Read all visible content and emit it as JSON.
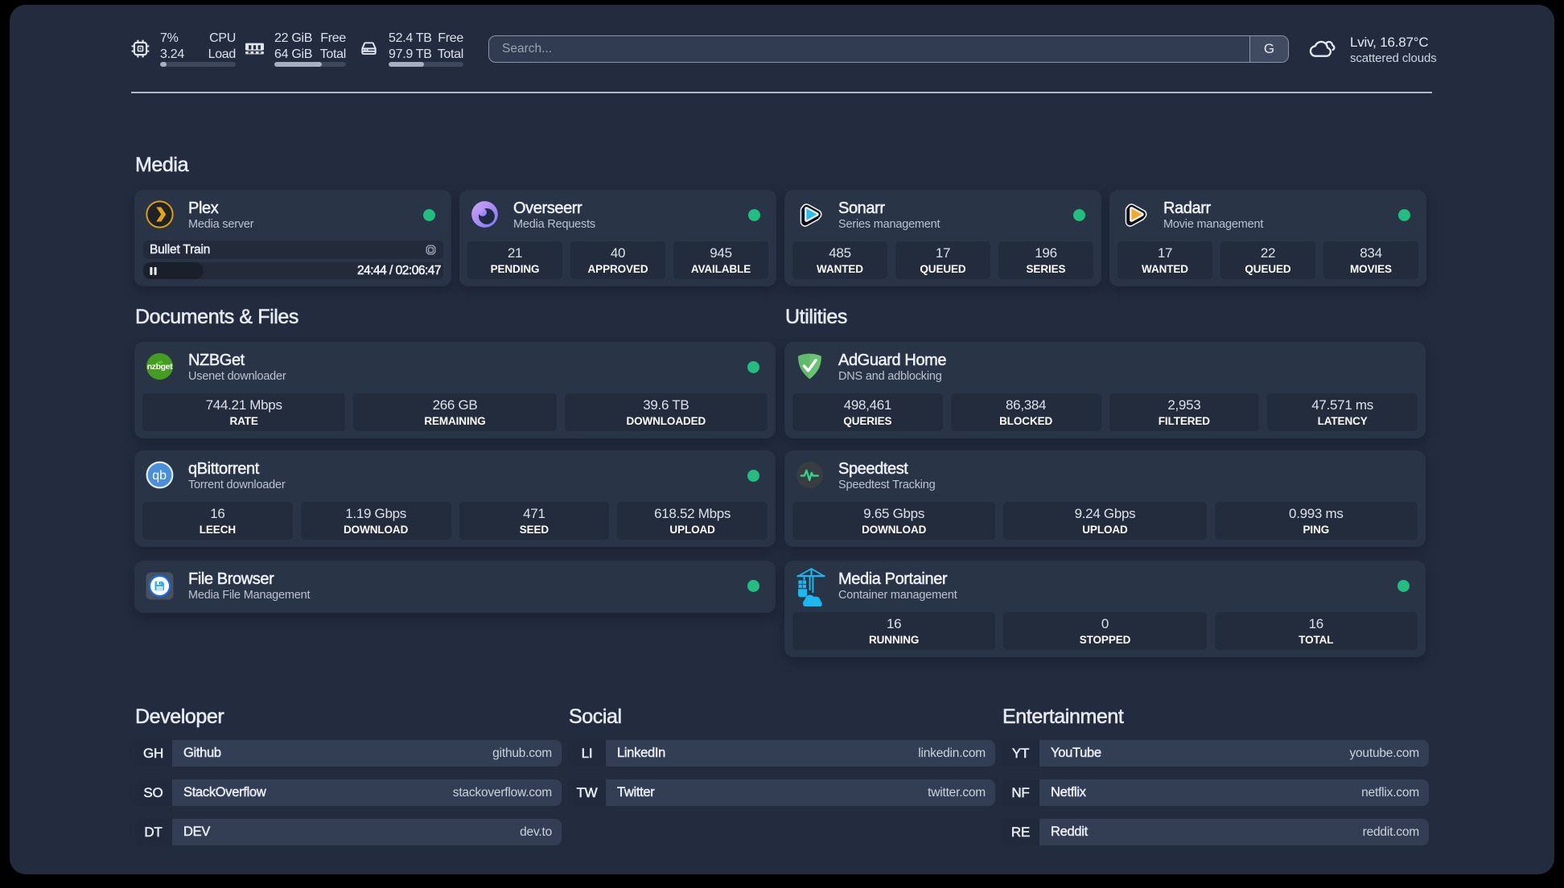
{
  "header": {
    "cpu": {
      "icon": "cpu-icon",
      "value_top": "7%",
      "value_bottom": "3.24",
      "label_top": "CPU",
      "label_bottom": "Load",
      "progress_pct": 8.5
    },
    "memory": {
      "icon": "ram-icon",
      "value_top": "22 GiB",
      "value_bottom": "64 GiB",
      "label_top": "Free",
      "label_bottom": "Total",
      "progress_pct": 66
    },
    "disk": {
      "icon": "disk-icon",
      "value_top": "52.4 TB",
      "value_bottom": "97.9 TB",
      "label_top": "Free",
      "label_bottom": "Total",
      "progress_pct": 47
    },
    "search": {
      "placeholder": "Search...",
      "engine": "G"
    },
    "weather": {
      "location": "Lviv, 16.87°C",
      "condition": "scattered clouds"
    }
  },
  "sections": {
    "media": {
      "title": "Media",
      "plex": {
        "name": "Plex",
        "description": "Media server",
        "now_playing": "Bullet Train",
        "time_display": "24:44 / 02:06:47",
        "progress_pct": 20.2,
        "status": "online"
      },
      "overseerr": {
        "name": "Overseerr",
        "description": "Media Requests",
        "status": "online",
        "stats": [
          {
            "value": "21",
            "label": "PENDING"
          },
          {
            "value": "40",
            "label": "APPROVED"
          },
          {
            "value": "945",
            "label": "AVAILABLE"
          }
        ]
      },
      "sonarr": {
        "name": "Sonarr",
        "description": "Series management",
        "status": "online",
        "stats": [
          {
            "value": "485",
            "label": "WANTED"
          },
          {
            "value": "17",
            "label": "QUEUED"
          },
          {
            "value": "196",
            "label": "SERIES"
          }
        ]
      },
      "radarr": {
        "name": "Radarr",
        "description": "Movie management",
        "status": "online",
        "stats": [
          {
            "value": "17",
            "label": "WANTED"
          },
          {
            "value": "22",
            "label": "QUEUED"
          },
          {
            "value": "834",
            "label": "MOVIES"
          }
        ]
      }
    },
    "documents": {
      "title": "Documents & Files",
      "nzbget": {
        "name": "NZBGet",
        "description": "Usenet downloader",
        "status": "online",
        "stats": [
          {
            "value": "744.21 Mbps",
            "label": "RATE"
          },
          {
            "value": "266 GB",
            "label": "REMAINING"
          },
          {
            "value": "39.6 TB",
            "label": "DOWNLOADED"
          }
        ]
      },
      "qbittorrent": {
        "name": "qBittorrent",
        "description": "Torrent downloader",
        "status": "online",
        "stats": [
          {
            "value": "16",
            "label": "LEECH"
          },
          {
            "value": "1.19 Gbps",
            "label": "DOWNLOAD"
          },
          {
            "value": "471",
            "label": "SEED"
          },
          {
            "value": "618.52 Mbps",
            "label": "UPLOAD"
          }
        ]
      },
      "filebrowser": {
        "name": "File Browser",
        "description": "Media File Management",
        "status": "online"
      }
    },
    "utilities": {
      "title": "Utilities",
      "adguard": {
        "name": "AdGuard Home",
        "description": "DNS and adblocking",
        "stats": [
          {
            "value": "498,461",
            "label": "QUERIES"
          },
          {
            "value": "86,384",
            "label": "BLOCKED"
          },
          {
            "value": "2,953",
            "label": "FILTERED"
          },
          {
            "value": "47.571 ms",
            "label": "LATENCY"
          }
        ]
      },
      "speedtest": {
        "name": "Speedtest",
        "description": "Speedtest Tracking",
        "stats": [
          {
            "value": "9.65 Gbps",
            "label": "DOWNLOAD"
          },
          {
            "value": "9.24 Gbps",
            "label": "UPLOAD"
          },
          {
            "value": "0.993 ms",
            "label": "PING"
          }
        ]
      },
      "portainer": {
        "name": "Media Portainer",
        "description": "Container management",
        "status": "online",
        "stats": [
          {
            "value": "16",
            "label": "RUNNING"
          },
          {
            "value": "0",
            "label": "STOPPED"
          },
          {
            "value": "16",
            "label": "TOTAL"
          }
        ]
      }
    },
    "links": {
      "developer": {
        "title": "Developer",
        "items": [
          {
            "abbr": "GH",
            "name": "Github",
            "url": "github.com"
          },
          {
            "abbr": "SO",
            "name": "StackOverflow",
            "url": "stackoverflow.com"
          },
          {
            "abbr": "DT",
            "name": "DEV",
            "url": "dev.to"
          }
        ]
      },
      "social": {
        "title": "Social",
        "items": [
          {
            "abbr": "LI",
            "name": "LinkedIn",
            "url": "linkedin.com"
          },
          {
            "abbr": "TW",
            "name": "Twitter",
            "url": "twitter.com"
          }
        ]
      },
      "entertainment": {
        "title": "Entertainment",
        "items": [
          {
            "abbr": "YT",
            "name": "YouTube",
            "url": "youtube.com"
          },
          {
            "abbr": "NF",
            "name": "Netflix",
            "url": "netflix.com"
          },
          {
            "abbr": "RE",
            "name": "Reddit",
            "url": "reddit.com"
          }
        ]
      }
    }
  },
  "colors": {
    "status_online": "#22BE7F",
    "background": "#232C3F",
    "card": "#2A3447"
  }
}
